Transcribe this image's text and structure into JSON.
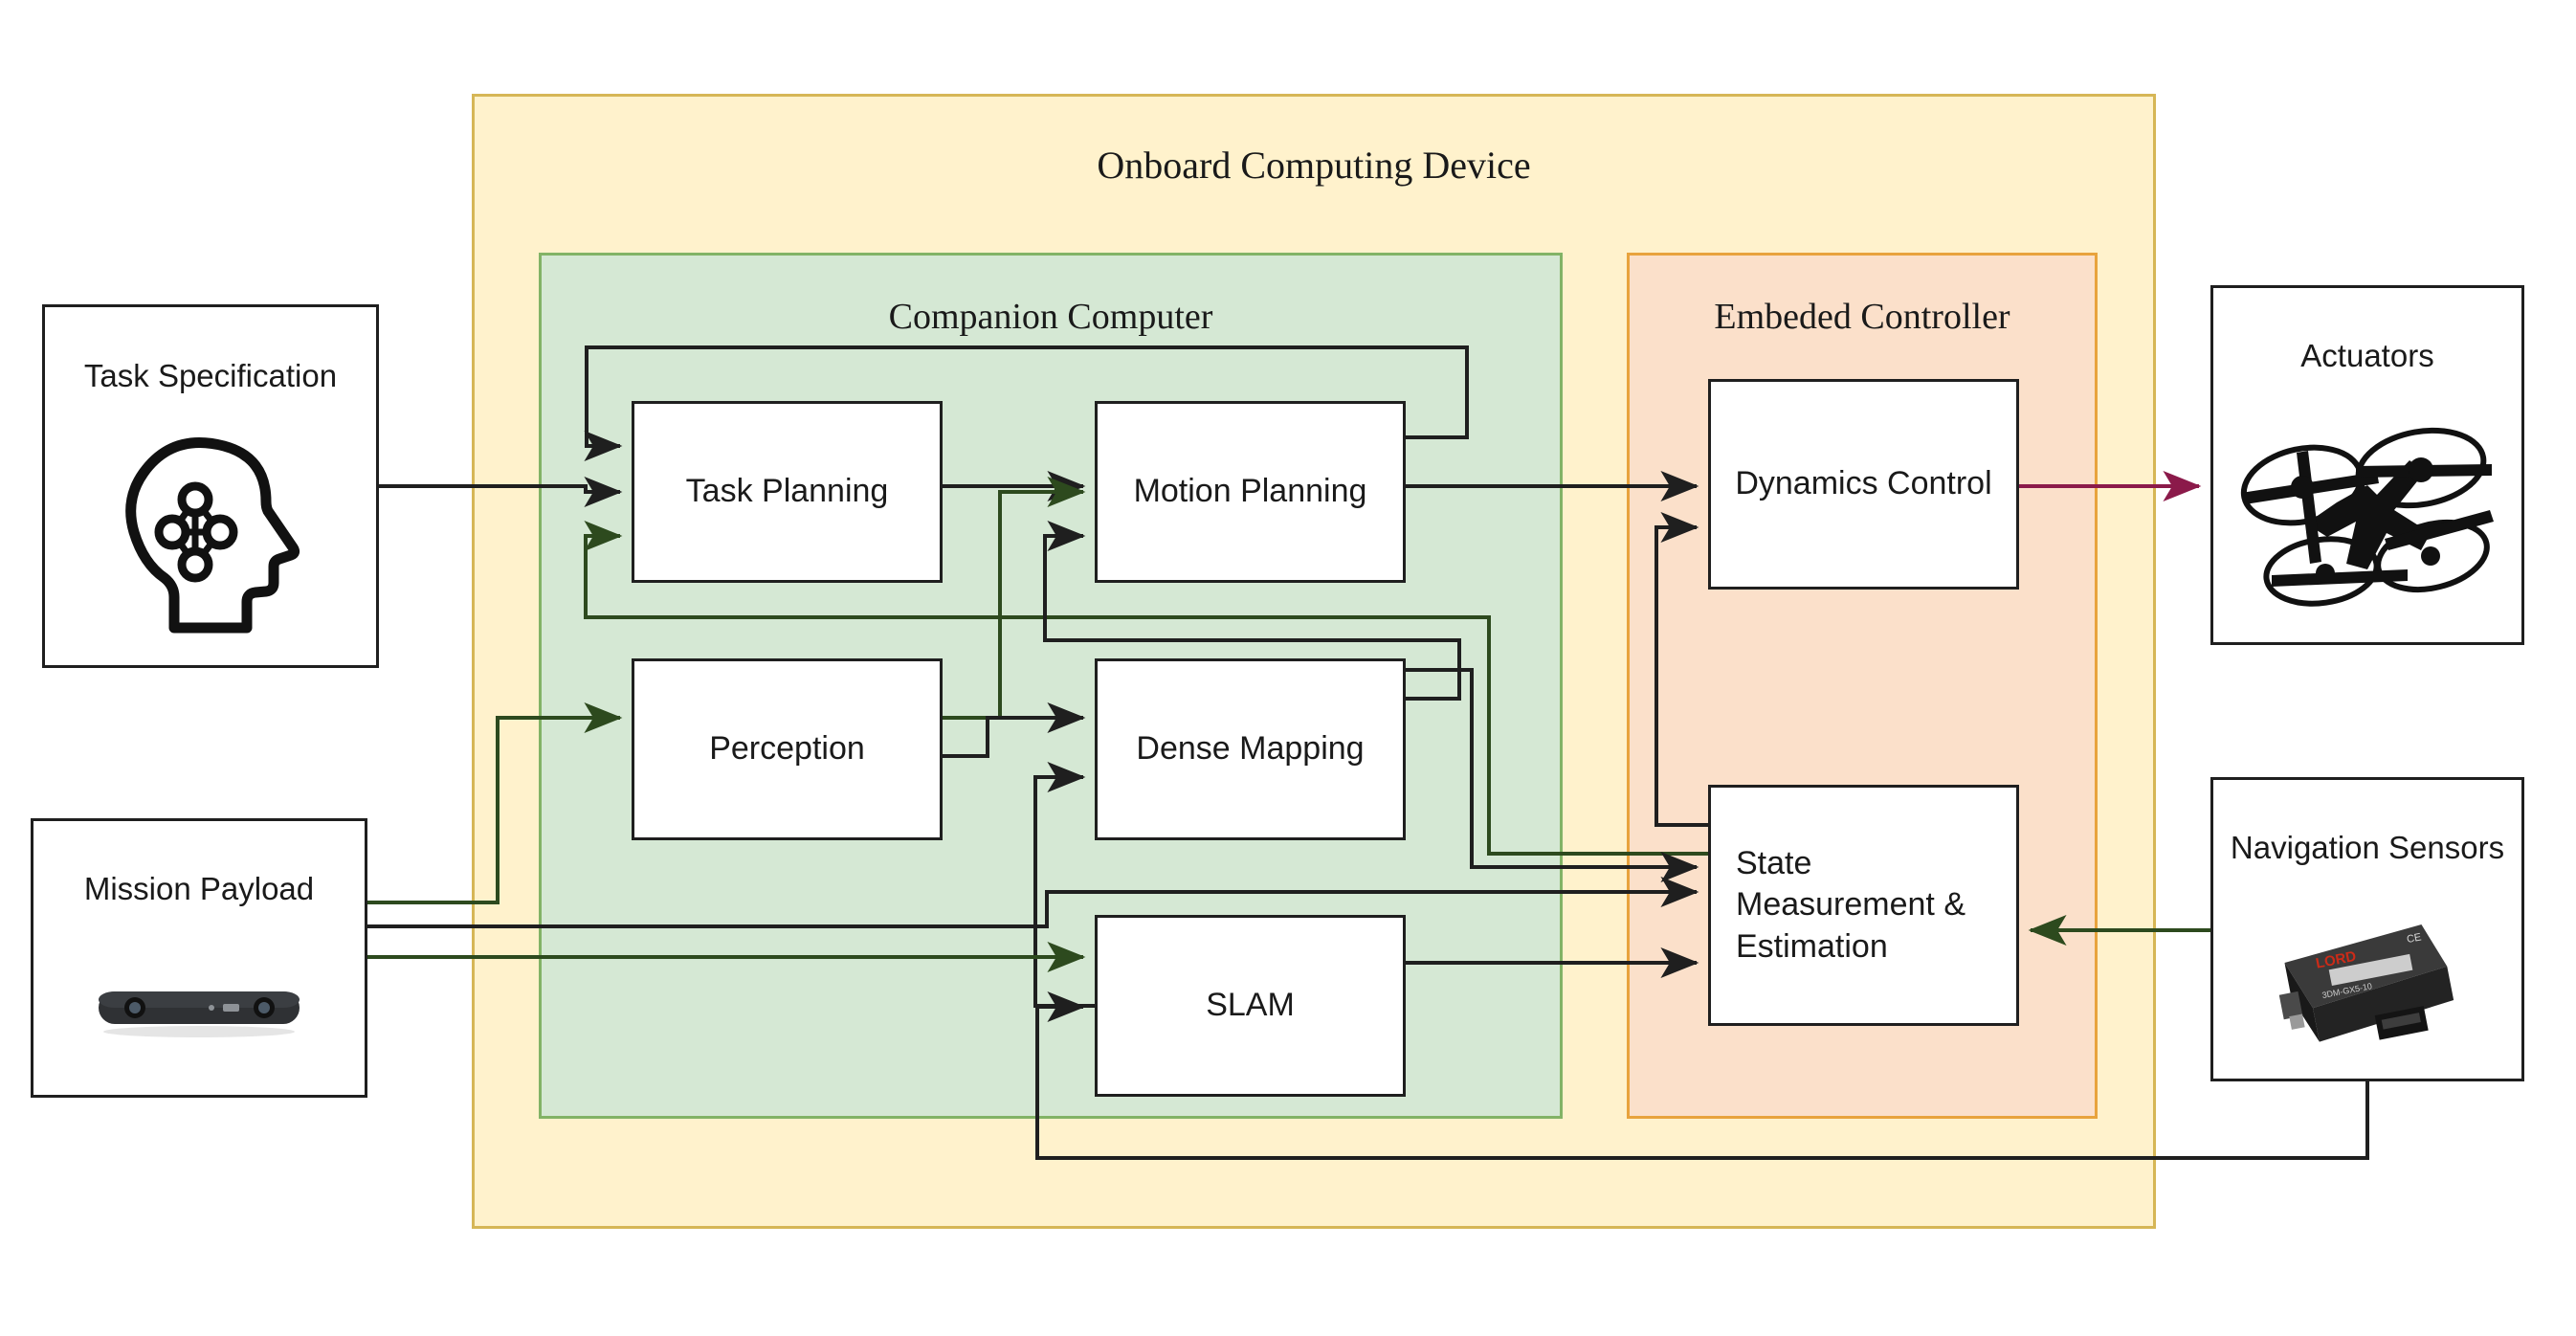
{
  "diagram": {
    "outer_container": {
      "title": "Onboard Computing Device",
      "fill": "#fff2cc",
      "stroke": "#d6b656"
    },
    "panels": [
      {
        "id": "companion",
        "title": "Companion Computer",
        "fill": "#d5e8d4",
        "stroke": "#82b366"
      },
      {
        "id": "embeded",
        "title": "Embeded Controller",
        "fill": "#fbe0ca",
        "stroke": "#e8a33d"
      }
    ],
    "nodes": [
      {
        "id": "task_planning",
        "label": "Task Planning",
        "panel": "companion"
      },
      {
        "id": "motion_planning",
        "label": "Motion Planning",
        "panel": "companion"
      },
      {
        "id": "perception",
        "label": "Perception",
        "panel": "companion"
      },
      {
        "id": "dense_mapping",
        "label": "Dense Mapping",
        "panel": "companion"
      },
      {
        "id": "slam",
        "label": "SLAM",
        "panel": "companion"
      },
      {
        "id": "dynamics_control",
        "label": "Dynamics Control",
        "panel": "embeded"
      },
      {
        "id": "state_estimation",
        "label": "State Measurement & Estimation",
        "panel": "embeded",
        "lines": [
          "State",
          "Measurement &",
          "Estimation"
        ]
      }
    ],
    "external": [
      {
        "id": "task_specification",
        "label": "Task Specification",
        "icon": "head-network-icon",
        "side": "left"
      },
      {
        "id": "mission_payload",
        "label": "Mission Payload",
        "icon": "depth-camera-icon",
        "side": "left"
      },
      {
        "id": "actuators",
        "label": "Actuators",
        "icon": "quadcopter-icon",
        "side": "right"
      },
      {
        "id": "navigation_sensors",
        "label": "Navigation Sensors",
        "icon": "imu-sensor-icon",
        "side": "right"
      }
    ],
    "edge_colors": {
      "black": "#1f1f1f",
      "green": "#2d4a1e",
      "magenta": "#8b1a4a"
    },
    "edges": [
      {
        "from": "task_specification",
        "to": "task_planning",
        "color": "black"
      },
      {
        "from": "motion_planning",
        "to": "task_planning",
        "color": "black"
      },
      {
        "from": "state_estimation",
        "to": "task_planning",
        "color": "green"
      },
      {
        "from": "task_planning",
        "to": "motion_planning",
        "color": "black"
      },
      {
        "from": "perception",
        "to": "motion_planning",
        "color": "green"
      },
      {
        "from": "dense_mapping",
        "to": "motion_planning",
        "color": "black"
      },
      {
        "from": "mission_payload",
        "to": "perception",
        "color": "green"
      },
      {
        "from": "perception",
        "to": "dense_mapping",
        "color": "black"
      },
      {
        "from": "slam",
        "to": "dense_mapping",
        "color": "black"
      },
      {
        "from": "mission_payload",
        "to": "slam",
        "color": "green"
      },
      {
        "from": "navigation_sensors",
        "to": "slam",
        "color": "black"
      },
      {
        "from": "motion_planning",
        "to": "dynamics_control",
        "color": "black"
      },
      {
        "from": "state_estimation",
        "to": "dynamics_control",
        "color": "black"
      },
      {
        "from": "dynamics_control",
        "to": "actuators",
        "color": "magenta"
      },
      {
        "from": "slam",
        "to": "state_estimation",
        "color": "black"
      },
      {
        "from": "dense_mapping",
        "to": "state_estimation",
        "color": "black"
      },
      {
        "from": "mission_payload",
        "to": "state_estimation",
        "color": "black"
      },
      {
        "from": "navigation_sensors",
        "to": "state_estimation",
        "color": "green"
      }
    ]
  }
}
